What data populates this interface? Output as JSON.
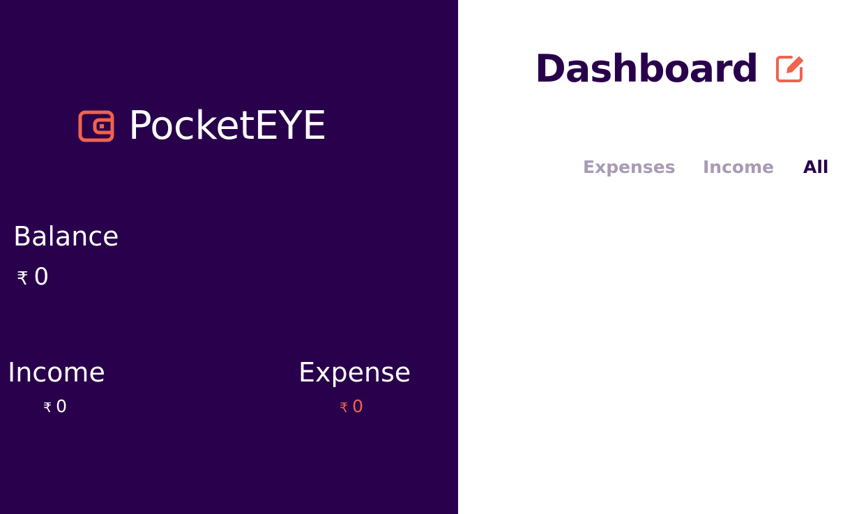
{
  "brand": {
    "name": "PocketEYE",
    "icon": "wallet-icon",
    "accent_color": "#f0634f",
    "sidebar_color": "#29004b"
  },
  "balance": {
    "label": "Balance",
    "currency_symbol": "₹",
    "amount": "0"
  },
  "income": {
    "label": "Income",
    "currency_symbol": "₹",
    "amount": "0"
  },
  "expense": {
    "label": "Expense",
    "currency_symbol": "₹",
    "amount": "0"
  },
  "dashboard": {
    "title": "Dashboard",
    "edit_icon": "edit-icon"
  },
  "tabs": [
    {
      "label": "Expenses",
      "active": false
    },
    {
      "label": "Income",
      "active": false
    },
    {
      "label": "All",
      "active": true
    }
  ]
}
